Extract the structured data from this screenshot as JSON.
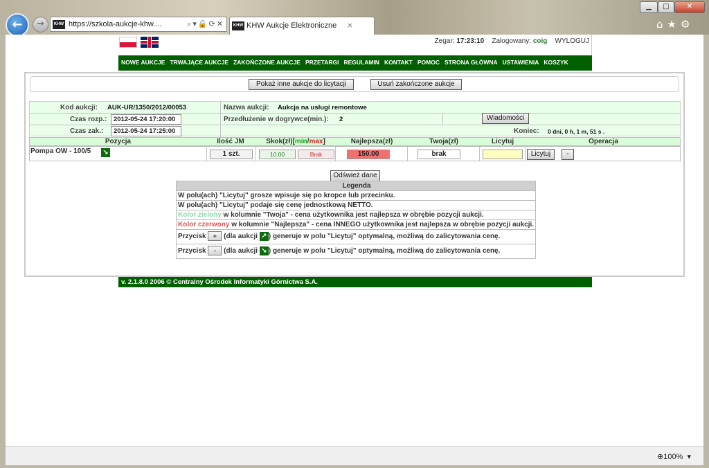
{
  "browser": {
    "address": "https://szkola-aukcje-khw....",
    "favicon_text": "KHW",
    "tab_title": "KHW Aukcje Elektroniczne",
    "zoom": "100%"
  },
  "header": {
    "clock_label": "Zegar:",
    "clock": "17:23:10",
    "logged_label": "Zalogowany:",
    "user": "coig",
    "logout": "WYLOGUJ"
  },
  "menu": [
    "NOWE AUKCJE",
    "TRWAJĄCE AUKCJE",
    "ZAKOŃCZONE AUKCJE",
    "PRZETARGI",
    "REGULAMIN",
    "KONTAKT",
    "POMOC",
    "STRONA GŁÓWNA",
    "USTAWIENIA",
    "KOSZYK"
  ],
  "actions": {
    "other": "Pokaż inne aukcje do licytacji",
    "remove": "Usuń zakończone aukcje",
    "refresh": "Odśwież dane",
    "messages": "Wiadomości",
    "bid": "Licytuj",
    "minus": "-",
    "plus": "+"
  },
  "auction": {
    "code_label": "Kod aukcji:",
    "code": "AUK-UR/1350/2012/00053",
    "name_label": "Nazwa aukcji:",
    "name": "Aukcja na usługi remontowe",
    "start_label": "Czas rozp.:",
    "start": "2012-05-24 17:20:00",
    "ext_label": "Przedłużenie w dogrywce(min.):",
    "ext": "2",
    "end_label": "Czas zak.:",
    "end": "2012-05-24 17:25:00",
    "remaining_label": "Koniec:",
    "remaining": "0 dni, 0 h, 1 m, 51 s ."
  },
  "table": {
    "headers": {
      "position": "Pozycja",
      "qty": "Ilość JM",
      "step": "Skok(zł)[",
      "step_min": "min",
      "step_slash": "/",
      "step_max": "max",
      "step_end": "]",
      "best": "Najlepsza(zł)",
      "yours": "Twoja(zł)",
      "bid": "Licytuj",
      "op": "Operacja"
    },
    "row": {
      "position": "Pompa OW - 100/5",
      "qty": "1 szt.",
      "min": "10.00",
      "max": "Brak",
      "best": "150.00",
      "yours": "brak",
      "bid": ""
    }
  },
  "legend": {
    "title": "Legenda",
    "l1": "W polu(ach) \"Licytuj\" grosze wpisuje się po kropce lub przecinku.",
    "l2": "W polu(ach) \"Licytuj\" podaje się cenę jednostkową NETTO.",
    "l3a": "Kolor zielony",
    "l3b": " w kolumnie \"Twoja\" - cena użytkownika jest najlepsza w obrębie pozycji aukcji.",
    "l4a": "Kolor czerwony",
    "l4b": " w kolumnie \"Najlepsza\" - cena INNEGO użytkownika jest najlepsza w obrębie pozycji aukcji.",
    "przycisk": "Przycisk",
    "dla": "(dla aukcji",
    "gen": ") generuje w polu \"Licytuj\" optymalną, możliwą do zalicytowania cenę."
  },
  "footer": "v. 2.1.8.0     2006 © Centralny Ośrodek Informatyki Górnictwa S.A.",
  "colors": {
    "menu_green": "#006000",
    "best_red": "#f07070",
    "legend_green": "#8fd8a8",
    "legend_red": "#e05050"
  }
}
